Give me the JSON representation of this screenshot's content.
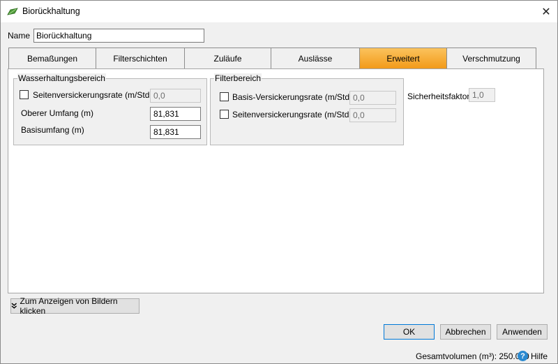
{
  "window": {
    "title": "Biorückhaltung",
    "icon": "bioretention-icon",
    "close_label": "✕"
  },
  "name_field": {
    "label": "Name",
    "value": "Biorückhaltung"
  },
  "tabs": [
    {
      "label": "Bemaßungen",
      "active": false
    },
    {
      "label": "Filterschichten",
      "active": false
    },
    {
      "label": "Zuläufe",
      "active": false
    },
    {
      "label": "Auslässe",
      "active": false
    },
    {
      "label": "Erweitert",
      "active": true
    },
    {
      "label": "Verschmutzung",
      "active": false
    }
  ],
  "wasserhaltung": {
    "title": "Wasserhaltungsbereich",
    "seiten_label": "Seitenversickerungsrate (m/Std.)",
    "seiten_checked": false,
    "seiten_value": "0,0",
    "oberer_label": "Oberer Umfang (m)",
    "oberer_value": "81,831",
    "basis_label": "Basisumfang (m)",
    "basis_value": "81,831"
  },
  "filter": {
    "title": "Filterbereich",
    "basis_label": "Basis-Versickerungsrate (m/Std.)",
    "basis_checked": false,
    "basis_value": "0,0",
    "seiten_label": "Seitenversickerungsrate (m/Std.)",
    "seiten_checked": false,
    "seiten_value": "0,0"
  },
  "sicherheit": {
    "label": "Sicherheitsfaktor",
    "value": "1,0"
  },
  "images_button": {
    "label": "Zum Anzeigen von Bildern klicken",
    "icon": "double-chevron-down-icon"
  },
  "buttons": {
    "ok": "OK",
    "cancel": "Abbrechen",
    "apply": "Anwenden"
  },
  "status": {
    "volume": "Gesamtvolumen (m³): 250.000",
    "help": "Hilfe",
    "help_icon": "help-icon"
  },
  "colors": {
    "active_tab": "#f29a19",
    "window_bg": "#f0f0f0",
    "default_button_border": "#0078d7",
    "help_icon": "#2b8ad0"
  }
}
